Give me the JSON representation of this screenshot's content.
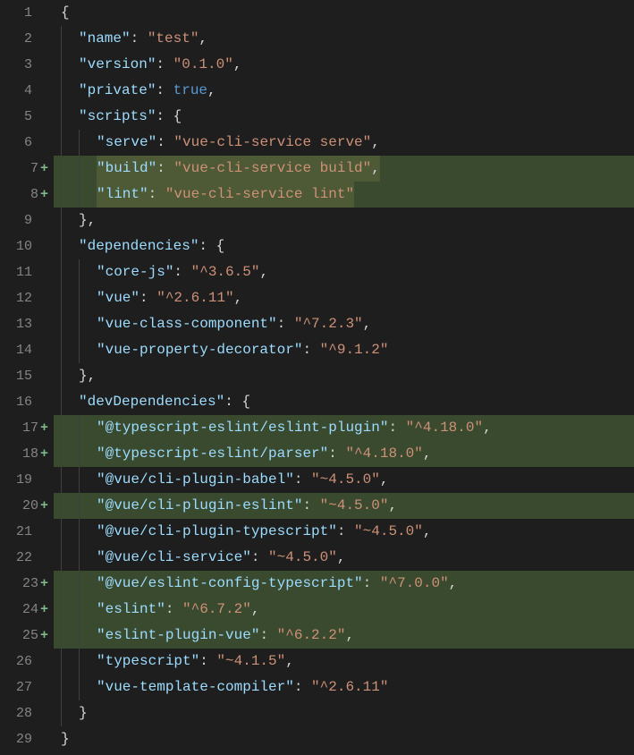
{
  "lines": [
    {
      "n": 1,
      "added": false,
      "indent": 0,
      "tokens": [
        {
          "t": "{",
          "c": "punct"
        }
      ]
    },
    {
      "n": 2,
      "added": false,
      "indent": 1,
      "tokens": [
        {
          "t": "\"name\"",
          "c": "key"
        },
        {
          "t": ": ",
          "c": "punct"
        },
        {
          "t": "\"test\"",
          "c": "str"
        },
        {
          "t": ",",
          "c": "punct"
        }
      ]
    },
    {
      "n": 3,
      "added": false,
      "indent": 1,
      "tokens": [
        {
          "t": "\"version\"",
          "c": "key"
        },
        {
          "t": ": ",
          "c": "punct"
        },
        {
          "t": "\"0.1.0\"",
          "c": "str"
        },
        {
          "t": ",",
          "c": "punct"
        }
      ]
    },
    {
      "n": 4,
      "added": false,
      "indent": 1,
      "tokens": [
        {
          "t": "\"private\"",
          "c": "key"
        },
        {
          "t": ": ",
          "c": "punct"
        },
        {
          "t": "true",
          "c": "bool"
        },
        {
          "t": ",",
          "c": "punct"
        }
      ]
    },
    {
      "n": 5,
      "added": false,
      "indent": 1,
      "tokens": [
        {
          "t": "\"scripts\"",
          "c": "key"
        },
        {
          "t": ": {",
          "c": "punct"
        }
      ]
    },
    {
      "n": 6,
      "added": false,
      "indent": 2,
      "tokens": [
        {
          "t": "\"serve\"",
          "c": "key"
        },
        {
          "t": ": ",
          "c": "punct"
        },
        {
          "t": "\"vue-cli-service serve\"",
          "c": "str"
        },
        {
          "t": ",",
          "c": "punct"
        }
      ]
    },
    {
      "n": 7,
      "added": true,
      "indent": 2,
      "hl": true,
      "tokens": [
        {
          "t": "\"build\"",
          "c": "key"
        },
        {
          "t": ": ",
          "c": "punct"
        },
        {
          "t": "\"vue-cli-service build\"",
          "c": "str"
        },
        {
          "t": ",",
          "c": "punct"
        }
      ]
    },
    {
      "n": 8,
      "added": true,
      "indent": 2,
      "hl": true,
      "tokens": [
        {
          "t": "\"lint\"",
          "c": "key"
        },
        {
          "t": ": ",
          "c": "punct"
        },
        {
          "t": "\"vue-cli-service lint\"",
          "c": "str"
        }
      ]
    },
    {
      "n": 9,
      "added": false,
      "indent": 1,
      "tokens": [
        {
          "t": "},",
          "c": "punct"
        }
      ]
    },
    {
      "n": 10,
      "added": false,
      "indent": 1,
      "tokens": [
        {
          "t": "\"dependencies\"",
          "c": "key"
        },
        {
          "t": ": {",
          "c": "punct"
        }
      ]
    },
    {
      "n": 11,
      "added": false,
      "indent": 2,
      "tokens": [
        {
          "t": "\"core-js\"",
          "c": "key"
        },
        {
          "t": ": ",
          "c": "punct"
        },
        {
          "t": "\"^3.6.5\"",
          "c": "str"
        },
        {
          "t": ",",
          "c": "punct"
        }
      ]
    },
    {
      "n": 12,
      "added": false,
      "indent": 2,
      "tokens": [
        {
          "t": "\"vue\"",
          "c": "key"
        },
        {
          "t": ": ",
          "c": "punct"
        },
        {
          "t": "\"^2.6.11\"",
          "c": "str"
        },
        {
          "t": ",",
          "c": "punct"
        }
      ]
    },
    {
      "n": 13,
      "added": false,
      "indent": 2,
      "tokens": [
        {
          "t": "\"vue-class-component\"",
          "c": "key"
        },
        {
          "t": ": ",
          "c": "punct"
        },
        {
          "t": "\"^7.2.3\"",
          "c": "str"
        },
        {
          "t": ",",
          "c": "punct"
        }
      ]
    },
    {
      "n": 14,
      "added": false,
      "indent": 2,
      "tokens": [
        {
          "t": "\"vue-property-decorator\"",
          "c": "key"
        },
        {
          "t": ": ",
          "c": "punct"
        },
        {
          "t": "\"^9.1.2\"",
          "c": "str"
        }
      ]
    },
    {
      "n": 15,
      "added": false,
      "indent": 1,
      "tokens": [
        {
          "t": "},",
          "c": "punct"
        }
      ]
    },
    {
      "n": 16,
      "added": false,
      "indent": 1,
      "tokens": [
        {
          "t": "\"devDependencies\"",
          "c": "key"
        },
        {
          "t": ": {",
          "c": "punct"
        }
      ]
    },
    {
      "n": 17,
      "added": true,
      "indent": 2,
      "tokens": [
        {
          "t": "\"@typescript-eslint/eslint-plugin\"",
          "c": "key"
        },
        {
          "t": ": ",
          "c": "punct"
        },
        {
          "t": "\"^4.18.0\"",
          "c": "str"
        },
        {
          "t": ",",
          "c": "punct"
        }
      ]
    },
    {
      "n": 18,
      "added": true,
      "indent": 2,
      "tokens": [
        {
          "t": "\"@typescript-eslint/parser\"",
          "c": "key"
        },
        {
          "t": ": ",
          "c": "punct"
        },
        {
          "t": "\"^4.18.0\"",
          "c": "str"
        },
        {
          "t": ",",
          "c": "punct"
        }
      ]
    },
    {
      "n": 19,
      "added": false,
      "indent": 2,
      "tokens": [
        {
          "t": "\"@vue/cli-plugin-babel\"",
          "c": "key"
        },
        {
          "t": ": ",
          "c": "punct"
        },
        {
          "t": "\"~4.5.0\"",
          "c": "str"
        },
        {
          "t": ",",
          "c": "punct"
        }
      ]
    },
    {
      "n": 20,
      "added": true,
      "indent": 2,
      "tokens": [
        {
          "t": "\"@vue/cli-plugin-eslint\"",
          "c": "key"
        },
        {
          "t": ": ",
          "c": "punct"
        },
        {
          "t": "\"~4.5.0\"",
          "c": "str"
        },
        {
          "t": ",",
          "c": "punct"
        }
      ]
    },
    {
      "n": 21,
      "added": false,
      "indent": 2,
      "tokens": [
        {
          "t": "\"@vue/cli-plugin-typescript\"",
          "c": "key"
        },
        {
          "t": ": ",
          "c": "punct"
        },
        {
          "t": "\"~4.5.0\"",
          "c": "str"
        },
        {
          "t": ",",
          "c": "punct"
        }
      ]
    },
    {
      "n": 22,
      "added": false,
      "indent": 2,
      "tokens": [
        {
          "t": "\"@vue/cli-service\"",
          "c": "key"
        },
        {
          "t": ": ",
          "c": "punct"
        },
        {
          "t": "\"~4.5.0\"",
          "c": "str"
        },
        {
          "t": ",",
          "c": "punct"
        }
      ]
    },
    {
      "n": 23,
      "added": true,
      "indent": 2,
      "tokens": [
        {
          "t": "\"@vue/eslint-config-typescript\"",
          "c": "key"
        },
        {
          "t": ": ",
          "c": "punct"
        },
        {
          "t": "\"^7.0.0\"",
          "c": "str"
        },
        {
          "t": ",",
          "c": "punct"
        }
      ]
    },
    {
      "n": 24,
      "added": true,
      "indent": 2,
      "tokens": [
        {
          "t": "\"eslint\"",
          "c": "key"
        },
        {
          "t": ": ",
          "c": "punct"
        },
        {
          "t": "\"^6.7.2\"",
          "c": "str"
        },
        {
          "t": ",",
          "c": "punct"
        }
      ]
    },
    {
      "n": 25,
      "added": true,
      "indent": 2,
      "tokens": [
        {
          "t": "\"eslint-plugin-vue\"",
          "c": "key"
        },
        {
          "t": ": ",
          "c": "punct"
        },
        {
          "t": "\"^6.2.2\"",
          "c": "str"
        },
        {
          "t": ",",
          "c": "punct"
        }
      ]
    },
    {
      "n": 26,
      "added": false,
      "indent": 2,
      "tokens": [
        {
          "t": "\"typescript\"",
          "c": "key"
        },
        {
          "t": ": ",
          "c": "punct"
        },
        {
          "t": "\"~4.1.5\"",
          "c": "str"
        },
        {
          "t": ",",
          "c": "punct"
        }
      ]
    },
    {
      "n": 27,
      "added": false,
      "indent": 2,
      "tokens": [
        {
          "t": "\"vue-template-compiler\"",
          "c": "key"
        },
        {
          "t": ": ",
          "c": "punct"
        },
        {
          "t": "\"^2.6.11\"",
          "c": "str"
        }
      ]
    },
    {
      "n": 28,
      "added": false,
      "indent": 1,
      "tokens": [
        {
          "t": "}",
          "c": "punct"
        }
      ]
    },
    {
      "n": 29,
      "added": false,
      "indent": 0,
      "tokens": [
        {
          "t": "}",
          "c": "punct"
        }
      ]
    }
  ]
}
